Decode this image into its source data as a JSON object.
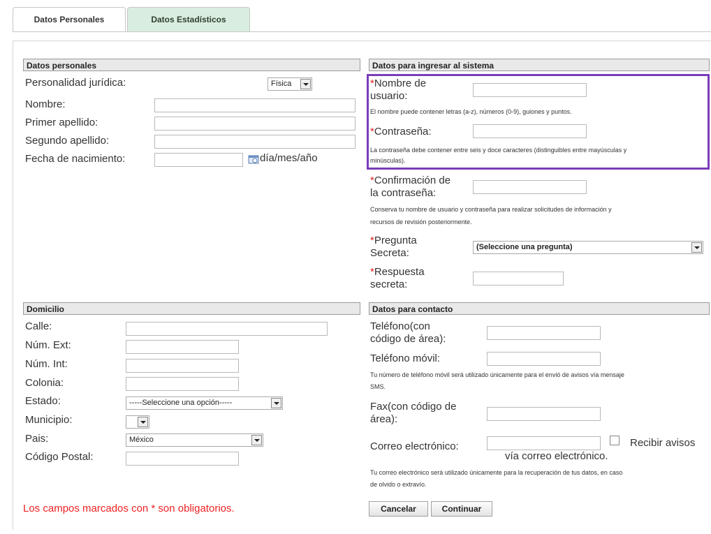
{
  "tabs": [
    "Datos Personales",
    "Datos Estadísticos"
  ],
  "personal": {
    "header": "Datos personales",
    "personalidad_label": "Personalidad jurídica:",
    "personalidad_value": "Física",
    "nombre_label": "Nombre:",
    "primer_apellido_label": "Primer apellido:",
    "segundo_apellido_label": "Segundo apellido:",
    "fecha_label": "Fecha de nacimiento:",
    "fecha_hint": "día/mes/año"
  },
  "sistema": {
    "header": "Datos para ingresar al sistema",
    "usuario_label_1": "Nombre de",
    "usuario_label_2": "usuario:",
    "usuario_help": "El nombre puede contener letras (a-z), números (0-9), guiones y puntos.",
    "contrasena_label": "Contraseña:",
    "contrasena_help_1": "La contraseña debe contener entre seis y doce caracteres (distinguibles entre mayúsculas y",
    "contrasena_help_2": "minúsculas).",
    "confirm_label_1": "Confirmación de",
    "confirm_label_2": "la contraseña:",
    "confirm_help_1": "Conserva tu nombre de usuario y contraseña para realizar solicitudes de información y",
    "confirm_help_2": "recursos de revisión posteriormente.",
    "pregunta_label_1": "Pregunta",
    "pregunta_label_2": "Secreta:",
    "pregunta_value": "(Seleccione una pregunta)",
    "respuesta_label_1": "Respuesta",
    "respuesta_label_2": "secreta:"
  },
  "domicilio": {
    "header": "Domicilio",
    "calle_label": "Calle:",
    "num_ext_label": "Núm. Ext:",
    "num_int_label": "Núm. Int:",
    "colonia_label": "Colonia:",
    "estado_label": "Estado:",
    "estado_value": "-----Seleccione una opción-----",
    "municipio_label": "Municipio:",
    "pais_label": "Pais:",
    "pais_value": "México",
    "cp_label": "Código Postal:"
  },
  "contacto": {
    "header": "Datos para contacto",
    "telefono_label_1": "Teléfono(con",
    "telefono_label_2": "código de área):",
    "movil_label": "Teléfono móvil:",
    "movil_help_1": "Tu número de teléfono móvil será utilizado únicamente para el envió de avisos vía mensaje",
    "movil_help_2": "SMS.",
    "fax_label_1": "Fax(con código de",
    "fax_label_2": "área):",
    "correo_label": "Correo electrónico:",
    "recibir_1": "Recibir avisos",
    "recibir_2": "vía correo electrónico.",
    "correo_help_1": "Tu correo electrónico será utilizado únicamente para la recuperación de tus datos, en caso",
    "correo_help_2": "de olvido o extravío."
  },
  "required_mark": "*",
  "footnote": "Los campos marcados con * son obligatorios.",
  "buttons": {
    "cancel": "Cancelar",
    "continue": "Continuar"
  },
  "colors": {
    "highlight": "#7a3db8",
    "required": "#dd2222",
    "active_tab": "#d9eee0"
  },
  "icons": [
    "calendar-icon",
    "dropdown-arrow-icon"
  ]
}
